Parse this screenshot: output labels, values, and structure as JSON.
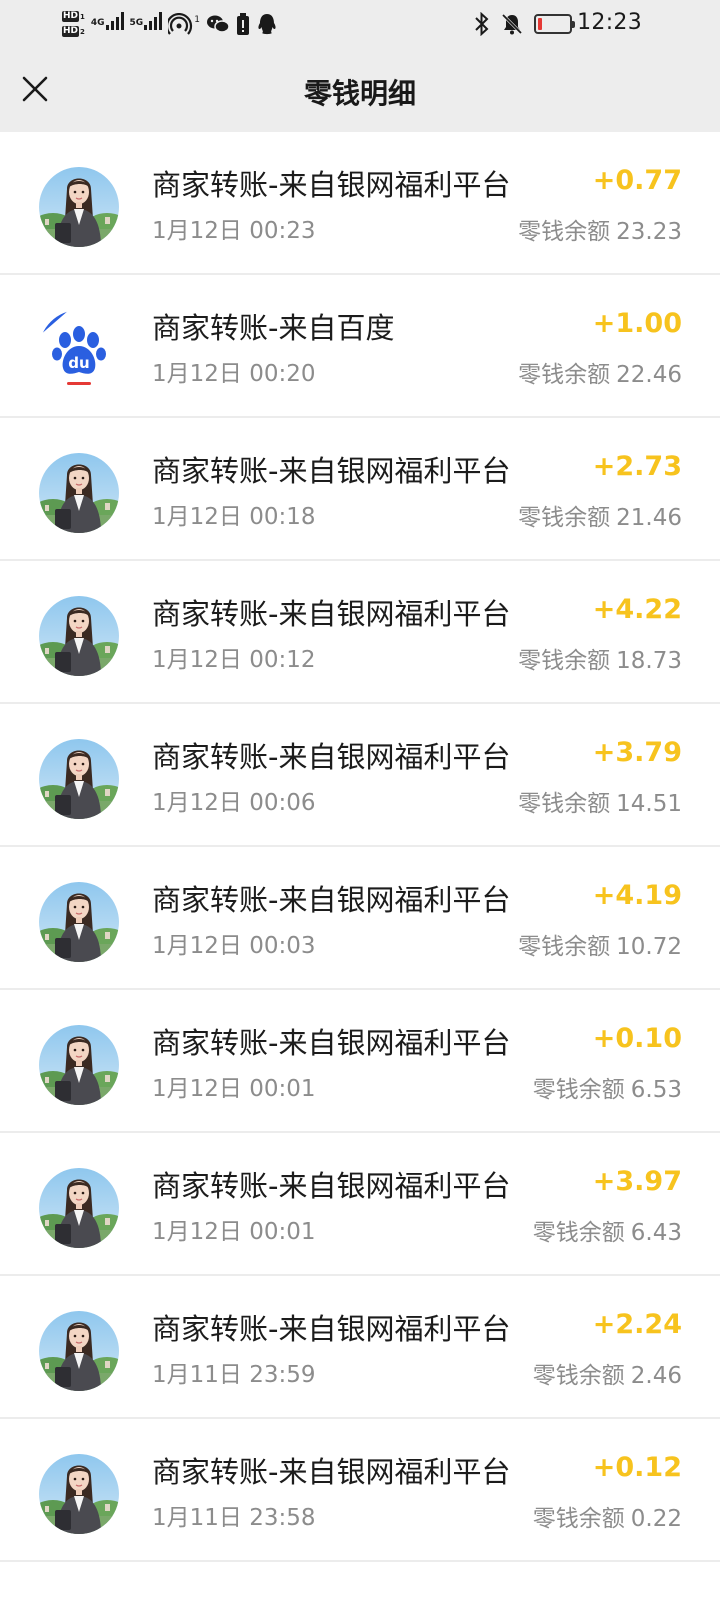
{
  "status_bar": {
    "time": "12:23",
    "hd1": "HD",
    "hd1_sub": "1",
    "hd2": "HD",
    "hd2_sub": "2",
    "net1": "4G",
    "net2": "5G",
    "hotspot_count": "1",
    "battery_level": 0.12,
    "icons": [
      "signal-icon",
      "hotspot-icon",
      "wechat-icon",
      "battery-saver-icon",
      "qq-icon",
      "bluetooth-icon",
      "mute-bell-icon",
      "battery-icon"
    ]
  },
  "header": {
    "title": "零钱明细",
    "close_icon": "close-icon"
  },
  "colors": {
    "amount": "#f7c31e",
    "header_bg": "#ededed",
    "subtext": "#8c8c8c"
  },
  "balance_label": "零钱余额",
  "transactions": [
    {
      "title": "商家转账-来自银网福利平台",
      "time": "1月12日 00:23",
      "amount": "+0.77",
      "balance": "23.23",
      "avatar": "woman-avatar"
    },
    {
      "title": "商家转账-来自百度",
      "time": "1月12日 00:20",
      "amount": "+1.00",
      "balance": "22.46",
      "avatar": "baidu-logo"
    },
    {
      "title": "商家转账-来自银网福利平台",
      "time": "1月12日 00:18",
      "amount": "+2.73",
      "balance": "21.46",
      "avatar": "woman-avatar"
    },
    {
      "title": "商家转账-来自银网福利平台",
      "time": "1月12日 00:12",
      "amount": "+4.22",
      "balance": "18.73",
      "avatar": "woman-avatar"
    },
    {
      "title": "商家转账-来自银网福利平台",
      "time": "1月12日 00:06",
      "amount": "+3.79",
      "balance": "14.51",
      "avatar": "woman-avatar"
    },
    {
      "title": "商家转账-来自银网福利平台",
      "time": "1月12日 00:03",
      "amount": "+4.19",
      "balance": "10.72",
      "avatar": "woman-avatar"
    },
    {
      "title": "商家转账-来自银网福利平台",
      "time": "1月12日 00:01",
      "amount": "+0.10",
      "balance": "6.53",
      "avatar": "woman-avatar"
    },
    {
      "title": "商家转账-来自银网福利平台",
      "time": "1月12日 00:01",
      "amount": "+3.97",
      "balance": "6.43",
      "avatar": "woman-avatar"
    },
    {
      "title": "商家转账-来自银网福利平台",
      "time": "1月11日 23:59",
      "amount": "+2.24",
      "balance": "2.46",
      "avatar": "woman-avatar"
    },
    {
      "title": "商家转账-来自银网福利平台",
      "time": "1月11日 23:58",
      "amount": "+0.12",
      "balance": "0.22",
      "avatar": "woman-avatar"
    }
  ]
}
